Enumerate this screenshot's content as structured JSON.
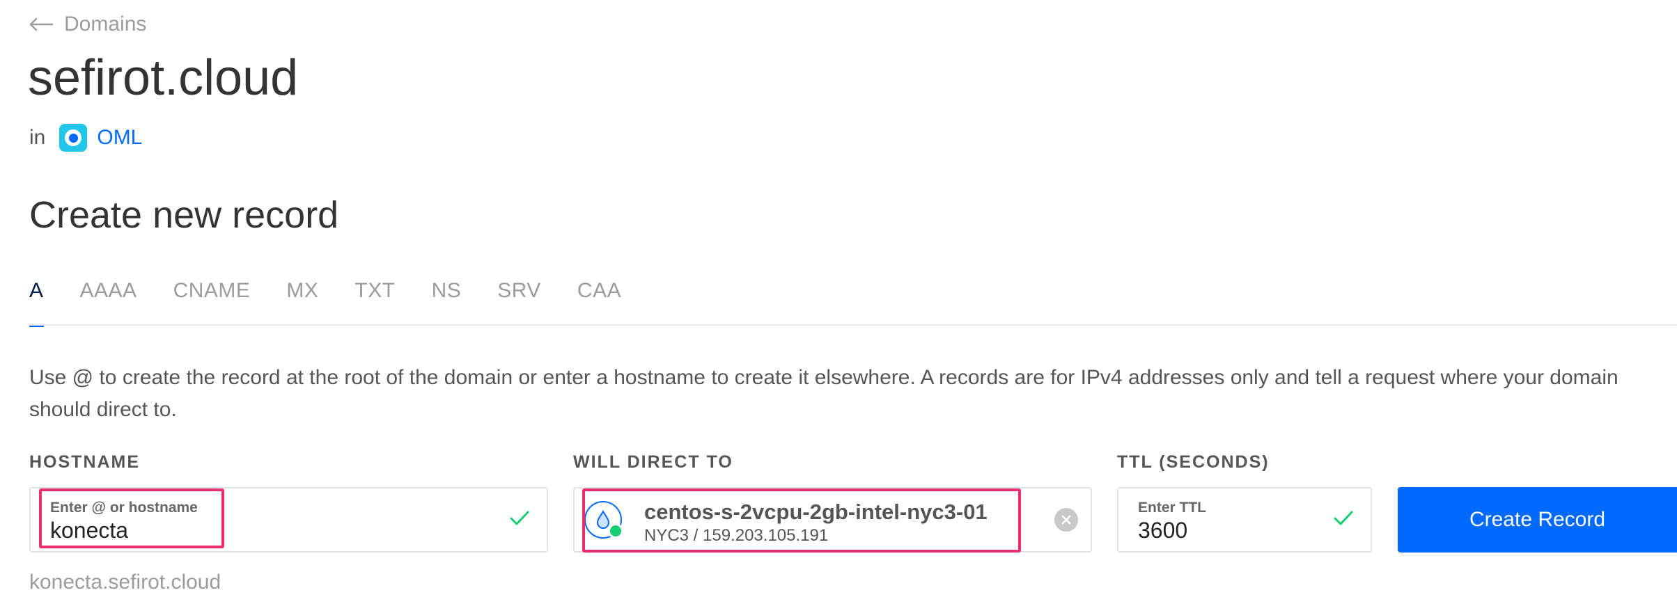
{
  "breadcrumb": {
    "back_label": "Domains"
  },
  "domain": {
    "name": "sefirot.cloud",
    "in_label": "in",
    "team": "OML"
  },
  "section_title": "Create new record",
  "tabs": [
    {
      "label": "A",
      "active": true
    },
    {
      "label": "AAAA",
      "active": false
    },
    {
      "label": "CNAME",
      "active": false
    },
    {
      "label": "MX",
      "active": false
    },
    {
      "label": "TXT",
      "active": false
    },
    {
      "label": "NS",
      "active": false
    },
    {
      "label": "SRV",
      "active": false
    },
    {
      "label": "CAA",
      "active": false
    }
  ],
  "description": "Use @ to create the record at the root of the domain or enter a hostname to create it elsewhere. A records are for IPv4 addresses only and tell a request where your domain should direct to.",
  "hostname": {
    "label": "HOSTNAME",
    "placeholder": "Enter @ or hostname",
    "value": "konecta",
    "fqdn": "konecta.sefirot.cloud"
  },
  "direct_to": {
    "label": "WILL DIRECT TO",
    "name": "centos-s-2vcpu-2gb-intel-nyc3-01",
    "sub": "NYC3 / 159.203.105.191"
  },
  "ttl": {
    "label": "TTL (SECONDS)",
    "placeholder": "Enter TTL",
    "value": "3600"
  },
  "create_button": "Create Record",
  "colors": {
    "accent": "#0069ff",
    "highlight": "#ee2e6b",
    "success": "#15cd72"
  },
  "icons": {
    "back": "arrow-left-icon",
    "team": "team-icon",
    "droplet": "droplet-icon",
    "check": "check-icon",
    "clear": "clear-icon"
  }
}
